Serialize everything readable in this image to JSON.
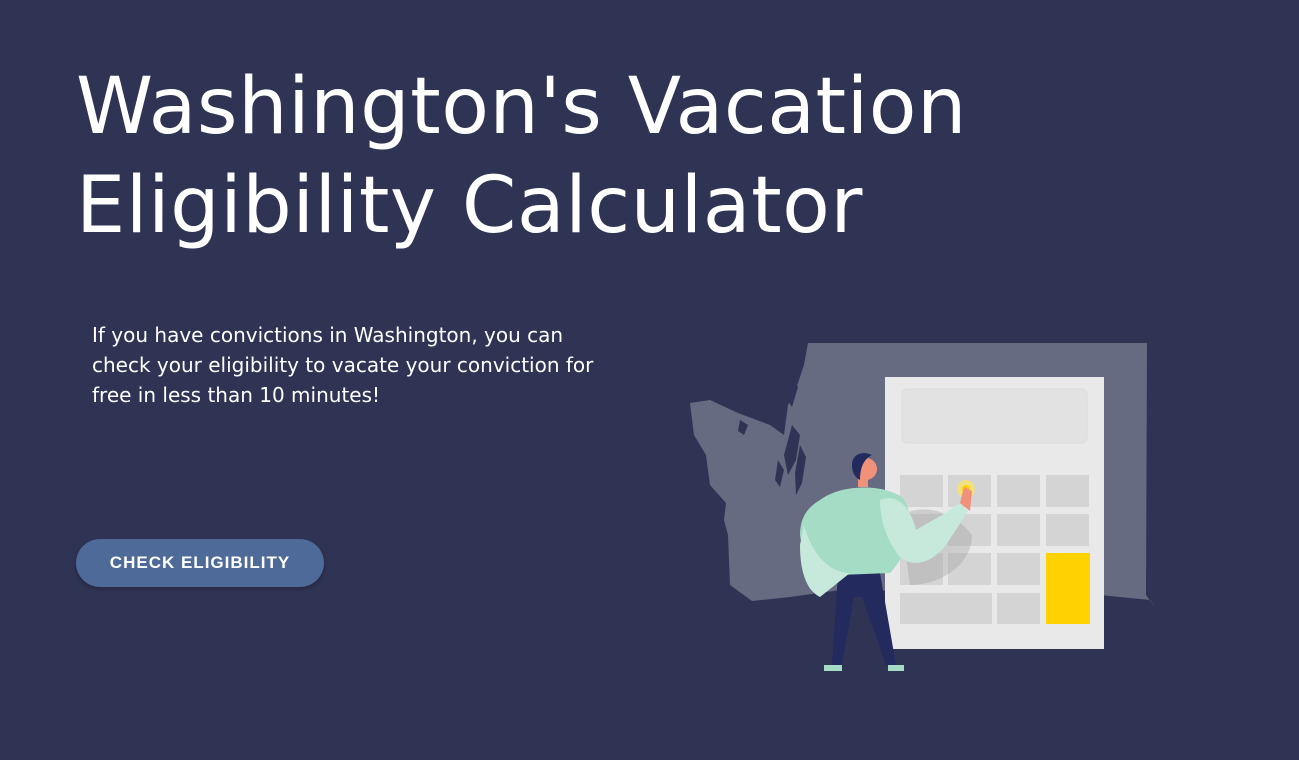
{
  "hero": {
    "title_line1": "Washington's Vacation",
    "title_line2": "Eligibility Calculator",
    "intro_line1": "If you have convictions in Washington, you can",
    "intro_line2": "check your eligibility to vacate your conviction for",
    "intro_line3": "free in less than 10 minutes!",
    "cta_label": "CHECK ELIGIBILITY"
  },
  "illustration": {
    "subject": "person-using-calculator-over-washington-map",
    "icons": [
      "washington-state-map-icon",
      "calculator-icon",
      "person-icon"
    ]
  },
  "colors": {
    "background": "#2f3454",
    "button": "#4d6a99",
    "text": "#ffffff",
    "map": "#666b82",
    "calculator_body": "#e9e9e9",
    "calculator_key": "#d4d4d4",
    "accent_key": "#ffd200",
    "shirt": "#a5dcc5",
    "pants": "#232a5e"
  }
}
